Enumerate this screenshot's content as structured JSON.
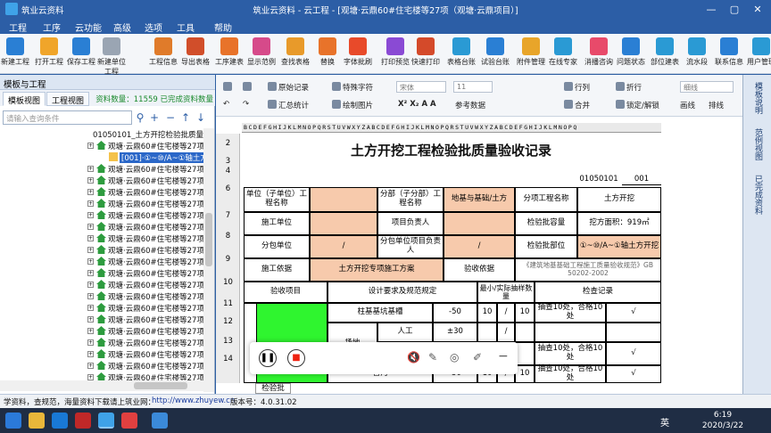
{
  "window": {
    "app_title": "筑业云资料",
    "title": "筑业云资料 - 云工程 - [观塘·云鼎60#住宅楼等27项（观塘·云鼎项目）]",
    "controls": [
      "—",
      "▢",
      "✕"
    ]
  },
  "menu": [
    "工程",
    "工序",
    "云功能",
    "高级",
    "选项",
    "工具",
    "帮助"
  ],
  "toolbar": [
    "新建工程",
    "打开工程",
    "保存工程",
    "新建单位工程",
    "工程信息",
    "导出表格",
    "工序建表",
    "显示范例",
    "查找表格",
    "替换",
    "字体批刷",
    "打印预览",
    "快速打印",
    "表格台账",
    "试验台账",
    "附件管理",
    "在线专家",
    "消播咨询",
    "问题状态",
    "部位建表",
    "流水段",
    "联系信息",
    "用户管理"
  ],
  "toolbar_colors": [
    "#2a7fd4",
    "#f0a52a",
    "#2a7fd4",
    "#9aa5b3",
    "#e07b2a",
    "#d14e2a",
    "#e8732a",
    "#d64a8a",
    "#e89a2a",
    "#e8732a",
    "#e84a2a",
    "#8a4ad4",
    "#d44a2a",
    "#2a9ad4",
    "#2a7fd4",
    "#e8a52a",
    "#2a9ad4",
    "#e84a6a",
    "#2a7fd4",
    "#2a9ad4",
    "#2a9ad4",
    "#2a7fd4",
    "#2a9ad4"
  ],
  "left": {
    "header": "模板与工程",
    "tabs": [
      "模板视图",
      "工程视图"
    ],
    "count": "资料数量：11559  已完成资料数量",
    "search_placeholder": "请输入查询条件",
    "nodes": [
      "01050101_土方开挖检验批质量验",
      "观塘·云鼎60#住宅楼等27项",
      "[001]·①~⑩/A~①轴土方开",
      "观塘·云鼎60#住宅楼等27项",
      "观塘·云鼎60#住宅楼等27项",
      "观塘·云鼎60#住宅楼等27项",
      "观塘·云鼎60#住宅楼等27项",
      "观塘·云鼎60#住宅楼等27项",
      "观塘·云鼎60#住宅楼等27项",
      "观塘·云鼎60#住宅楼等27项",
      "观塘·云鼎60#住宅楼等27项",
      "观塘·云鼎60#住宅楼等27项",
      "观塘·云鼎60#住宅楼等27项",
      "观塘·云鼎60#住宅楼等27项",
      "观塘·云鼎60#住宅楼等27项",
      "观塘·云鼎60#住宅楼等27项",
      "观塘·云鼎60#住宅楼等27项",
      "观塘·云鼎60#住宅楼等27项",
      "观塘·云鼎60#住宅楼等27项",
      "观塘·云鼎60#住宅楼等27项",
      "观塘·云鼎60#住宅楼等27项",
      "观塘·云鼎60#住宅楼等27项"
    ]
  },
  "ribbon": {
    "orig_record": "原始记录",
    "special_char": "特殊字符",
    "font": "宋体",
    "size": "11",
    "row_col": "行列",
    "wrap": "折行",
    "line": "细线",
    "summary": "汇总统计",
    "draw_pic": "绘制图片",
    "ref_data": "参考数据",
    "merge": "合并",
    "lock": "锁定/解锁",
    "line2": "画线",
    "layout": "排线"
  },
  "colheader": "BCDEFGHIJKLMNOPQRSTUVWXYZABCDEFGHIJKLMNOPQRSTUVWXYZABCDEFGHIJKLMNOPQ",
  "rows": [
    "2",
    "3",
    "4",
    "6",
    "7",
    "8",
    "9",
    "10",
    "11",
    "12",
    "13",
    "14"
  ],
  "sheet": {
    "title": "土方开挖工程检验批质量验收记录",
    "code": "01050101",
    "seq": "001",
    "r6": [
      "单位（子单位）工程名称",
      "分部（子分部）工程名称",
      "地基与基础/土方",
      "分项工程名称",
      "土方开挖"
    ],
    "r7": [
      "施工单位",
      "项目负责人",
      "检验批容量",
      "挖方面积：919㎡"
    ],
    "r8": [
      "分包单位",
      "/",
      "分包单位项目负责人",
      "/",
      "检验批部位",
      "①~⑩/A~①轴土方开挖"
    ],
    "r9": [
      "施工依据",
      "土方开挖专项施工方案",
      "验收依据",
      "《建筑地基基础工程施工质量验收规范》GB 50202-2002"
    ],
    "r10": [
      "验收项目",
      "设计要求及规范规定",
      "最小/实际抽样数量",
      "检查记录"
    ],
    "r11": [
      "柱基基坑基槽",
      "-50",
      "10",
      "/",
      "10",
      "抽查10处，合格10处",
      "√"
    ],
    "r12": [
      "场地",
      "人工",
      "±30",
      "/"
    ],
    "r13": [
      "机械",
      "抽查10处，合格10处",
      "√"
    ],
    "r14": [
      "管沟",
      "-50",
      "10",
      "/",
      "10",
      "抽查10处，合格10处",
      "√"
    ]
  },
  "sheet_tab": "检验批",
  "right_strip": [
    "模板说明",
    "范例视图",
    "已完成资料"
  ],
  "status": {
    "text": "学资料，查规范，海量资料下载请上筑业网：",
    "url": "http://www.zhuyew.cn",
    "version": "版本号：4.0.31.02"
  },
  "taskbar": {
    "lang": "英",
    "time": "6:19",
    "date": "2020/3/22"
  }
}
